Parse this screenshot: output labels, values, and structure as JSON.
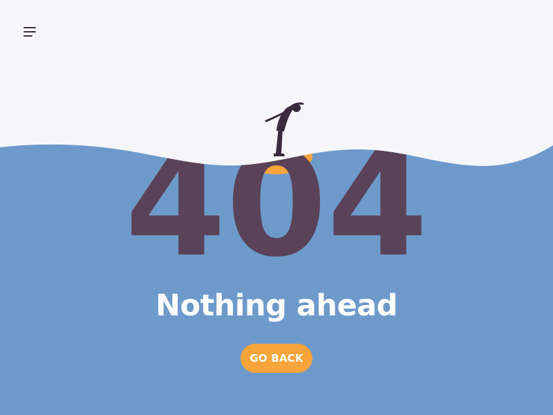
{
  "colors": {
    "background": "#f6f6fa",
    "water": "#6e9acb",
    "digits": "#5a4258",
    "highlight": "#f7a43b",
    "figure": "#3a2a3e",
    "text": "#ffffff"
  },
  "menu": {
    "icon": "hamburger-menu-icon"
  },
  "error": {
    "code": "404"
  },
  "headline": "Nothing ahead",
  "go_back_button": {
    "label": "GO BACK"
  }
}
